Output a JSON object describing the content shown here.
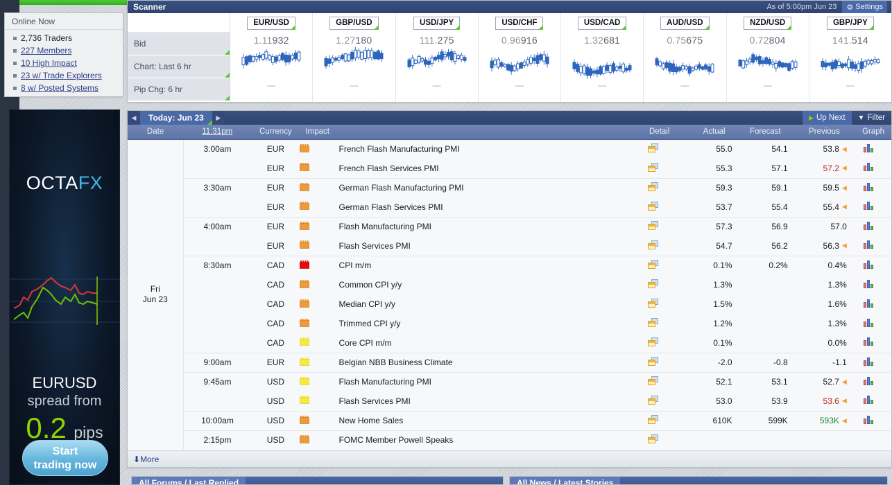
{
  "left": {
    "online_box": {
      "title": "Online Now",
      "items": [
        {
          "label": "2,736 Traders",
          "link": false
        },
        {
          "label": "227 Members",
          "link": true
        },
        {
          "label": "10 High Impact",
          "link": true
        },
        {
          "label": "23 w/ Trade Explorers",
          "link": true
        },
        {
          "label": "8 w/ Posted Systems",
          "link": true
        }
      ]
    },
    "ad": {
      "logo_first": "OCTA",
      "logo_second": "FX",
      "headline": "EURUSD",
      "subline": "spread from",
      "value": "0.2",
      "unit": "pips",
      "cta_line1": "Start",
      "cta_line2": "trading now",
      "accent_green": "#8fd400",
      "accent_blue": "#41b6e6"
    }
  },
  "scanner": {
    "title": "Scanner",
    "as_of": "As of 5:00pm Jun 23",
    "settings_label": "Settings",
    "settings_icon": "gear-icon",
    "row_labels": [
      "Bid",
      "Chart: Last 6 hr",
      "Pip Chg: 6 hr"
    ],
    "pairs": [
      {
        "pair": "EUR/USD",
        "bid": "1.11932",
        "bid_big": "932",
        "pip_chg": "—"
      },
      {
        "pair": "GBP/USD",
        "bid": "1.27180",
        "bid_big": "180",
        "pip_chg": "—"
      },
      {
        "pair": "USD/JPY",
        "bid": "111.275",
        "bid_big": "275",
        "pip_chg": "—"
      },
      {
        "pair": "USD/CHF",
        "bid": "0.96916",
        "bid_big": "916",
        "pip_chg": "—"
      },
      {
        "pair": "USD/CAD",
        "bid": "1.32681",
        "bid_big": "681",
        "pip_chg": "—"
      },
      {
        "pair": "AUD/USD",
        "bid": "0.75675",
        "bid_big": "675",
        "pip_chg": "—"
      },
      {
        "pair": "NZD/USD",
        "bid": "0.72804",
        "bid_big": "804",
        "pip_chg": "—"
      },
      {
        "pair": "GBP/JPY",
        "bid": "141.514",
        "bid_big": "514",
        "pip_chg": "—"
      }
    ]
  },
  "calendar": {
    "prev_arrow": "◀",
    "next_arrow": "▶",
    "today_label": "Today: Jun 23",
    "up_next_label": "Up Next",
    "filter_label": "Filter",
    "columns": {
      "date": "Date",
      "time": "11:31pm",
      "currency": "Currency",
      "impact": "Impact",
      "event": "",
      "detail": "Detail",
      "actual": "Actual",
      "forecast": "Forecast",
      "previous": "Previous",
      "graph": "Graph"
    },
    "date_line1": "Fri",
    "date_line2": "Jun 23",
    "more_label": "More",
    "rows": [
      {
        "group_start": true,
        "time": "3:00am",
        "currency": "EUR",
        "impact": "orange",
        "event": "French Flash Manufacturing PMI",
        "actual": "55.0",
        "actual_tone": "up",
        "forecast": "54.1",
        "previous": "53.8",
        "previous_tone": "neutral",
        "revised": true
      },
      {
        "group_start": false,
        "time": "",
        "currency": "EUR",
        "impact": "orange",
        "event": "French Flash Services PMI",
        "actual": "55.3",
        "actual_tone": "down",
        "forecast": "57.1",
        "previous": "57.2",
        "previous_tone": "down",
        "revised": true
      },
      {
        "group_start": true,
        "time": "3:30am",
        "currency": "EUR",
        "impact": "orange",
        "event": "German Flash Manufacturing PMI",
        "actual": "59.3",
        "actual_tone": "neutral",
        "forecast": "59.1",
        "previous": "59.5",
        "previous_tone": "neutral",
        "revised": true
      },
      {
        "group_start": false,
        "time": "",
        "currency": "EUR",
        "impact": "orange",
        "event": "German Flash Services PMI",
        "actual": "53.7",
        "actual_tone": "down",
        "forecast": "55.4",
        "previous": "55.4",
        "previous_tone": "neutral",
        "revised": true
      },
      {
        "group_start": true,
        "time": "4:00am",
        "currency": "EUR",
        "impact": "orange",
        "event": "Flash Manufacturing PMI",
        "actual": "57.3",
        "actual_tone": "up",
        "forecast": "56.9",
        "previous": "57.0",
        "previous_tone": "neutral",
        "revised": false
      },
      {
        "group_start": false,
        "time": "",
        "currency": "EUR",
        "impact": "orange",
        "event": "Flash Services PMI",
        "actual": "54.7",
        "actual_tone": "down",
        "forecast": "56.2",
        "previous": "56.3",
        "previous_tone": "neutral",
        "revised": true
      },
      {
        "group_start": true,
        "time": "8:30am",
        "currency": "CAD",
        "impact": "red",
        "event": "CPI m/m",
        "actual": "0.1%",
        "actual_tone": "down",
        "forecast": "0.2%",
        "previous": "0.4%",
        "previous_tone": "neutral",
        "revised": false
      },
      {
        "group_start": false,
        "time": "",
        "currency": "CAD",
        "impact": "orange",
        "event": "Common CPI y/y",
        "actual": "1.3%",
        "actual_tone": "neutral",
        "forecast": "",
        "previous": "1.3%",
        "previous_tone": "neutral",
        "revised": false
      },
      {
        "group_start": false,
        "time": "",
        "currency": "CAD",
        "impact": "orange",
        "event": "Median CPI y/y",
        "actual": "1.5%",
        "actual_tone": "neutral",
        "forecast": "",
        "previous": "1.6%",
        "previous_tone": "neutral",
        "revised": false
      },
      {
        "group_start": false,
        "time": "",
        "currency": "CAD",
        "impact": "orange",
        "event": "Trimmed CPI y/y",
        "actual": "1.2%",
        "actual_tone": "neutral",
        "forecast": "",
        "previous": "1.3%",
        "previous_tone": "neutral",
        "revised": false
      },
      {
        "group_start": false,
        "time": "",
        "currency": "CAD",
        "impact": "yellow",
        "event": "Core CPI m/m",
        "actual": "0.1%",
        "actual_tone": "neutral",
        "forecast": "",
        "previous": "0.0%",
        "previous_tone": "neutral",
        "revised": false
      },
      {
        "group_start": true,
        "time": "9:00am",
        "currency": "EUR",
        "impact": "yellow",
        "event": "Belgian NBB Business Climate",
        "actual": "-2.0",
        "actual_tone": "down",
        "forecast": "-0.8",
        "previous": "-1.1",
        "previous_tone": "neutral",
        "revised": false
      },
      {
        "group_start": true,
        "time": "9:45am",
        "currency": "USD",
        "impact": "yellow",
        "event": "Flash Manufacturing PMI",
        "actual": "52.1",
        "actual_tone": "down",
        "forecast": "53.1",
        "previous": "52.7",
        "previous_tone": "neutral",
        "revised": true
      },
      {
        "group_start": false,
        "time": "",
        "currency": "USD",
        "impact": "yellow",
        "event": "Flash Services PMI",
        "actual": "53.0",
        "actual_tone": "down",
        "forecast": "53.9",
        "previous": "53.6",
        "previous_tone": "down",
        "revised": true
      },
      {
        "group_start": true,
        "time": "10:00am",
        "currency": "USD",
        "impact": "orange",
        "event": "New Home Sales",
        "actual": "610K",
        "actual_tone": "up",
        "forecast": "599K",
        "previous": "593K",
        "previous_tone": "up",
        "revised": true
      },
      {
        "group_start": true,
        "time": "2:15pm",
        "currency": "USD",
        "impact": "orange",
        "event": "FOMC Member Powell Speaks",
        "actual": "",
        "actual_tone": "neutral",
        "forecast": "",
        "previous": "",
        "previous_tone": "neutral",
        "revised": false
      }
    ]
  },
  "bottom_panels": [
    {
      "title": "All Forums / Last Replied"
    },
    {
      "title": "All News / Latest Stories"
    }
  ]
}
